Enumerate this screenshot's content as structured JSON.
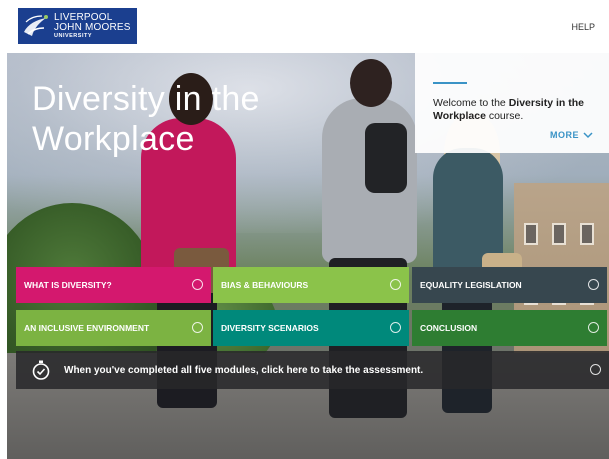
{
  "header": {
    "logo": {
      "line1": "LIVERPOOL",
      "line2": "JOHN MOORES",
      "line3": "UNIVERSITY"
    },
    "help_label": "HELP"
  },
  "hero": {
    "title": "Diversity in the Workplace"
  },
  "welcome": {
    "prefix": "Welcome to the ",
    "course_name": "Diversity in the Workplace",
    "suffix": " course.",
    "more_label": "MORE"
  },
  "modules": [
    {
      "label": "WHAT IS DIVERSITY?",
      "color": "#d4186e"
    },
    {
      "label": "BIAS & BEHAVIOURS",
      "color": "#8bc34a"
    },
    {
      "label": "EQUALITY LEGISLATION",
      "color": "#37474f"
    },
    {
      "label": "AN INCLUSIVE ENVIRONMENT",
      "color": "#7cb342"
    },
    {
      "label": "DIVERSITY SCENARIOS",
      "color": "#00897b"
    },
    {
      "label": "CONCLUSION",
      "color": "#2e7d32"
    }
  ],
  "assessment": {
    "label": "When you've completed all five modules, click here to take the assessment."
  },
  "colors": {
    "brand_blue": "#1b3f8f",
    "accent_blue": "#3a93c6"
  }
}
